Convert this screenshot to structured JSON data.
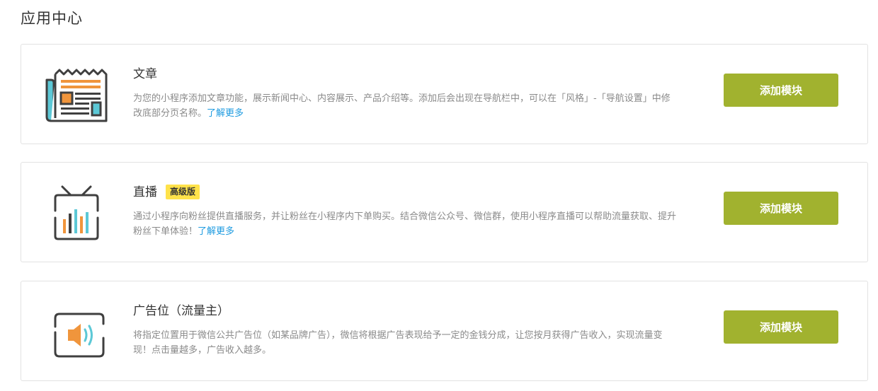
{
  "page": {
    "title": "应用中心"
  },
  "modules": [
    {
      "icon": "newspaper-icon",
      "title": "文章",
      "badge": "",
      "description": "为您的小程序添加文章功能，展示新闻中心、内容展示、产品介绍等。添加后会出现在导航栏中，可以在「风格」-「导航设置」中修改底部分页名称。",
      "learn_more": "了解更多",
      "button_label": "添加模块"
    },
    {
      "icon": "tv-live-icon",
      "title": "直播",
      "badge": "高级版",
      "description": "通过小程序向粉丝提供直播服务，并让粉丝在小程序内下单购买。结合微信公众号、微信群，使用小程序直播可以帮助流量获取、提升粉丝下单体验！",
      "learn_more": "了解更多",
      "button_label": "添加模块"
    },
    {
      "icon": "speaker-screen-icon",
      "title": "广告位（流量主）",
      "badge": "",
      "description": "将指定位置用于微信公共广告位（如某品牌广告），微信将根据广告表现给予一定的金钱分成，让您按月获得广告收入，实现流量变现！点击量越多，广告收入越多。",
      "learn_more": "",
      "button_label": "添加模块"
    }
  ],
  "colors": {
    "button": "#a1b22f",
    "link": "#1e9be0",
    "badge": "#ffe24a",
    "icon_dark": "#3f3f3f",
    "icon_orange": "#f0953c",
    "icon_teal": "#5cc8d6"
  }
}
